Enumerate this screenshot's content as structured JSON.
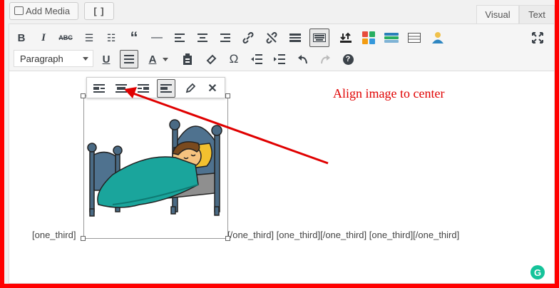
{
  "media": {
    "add_media_label": "Add Media",
    "shortcode_label": "[ ]"
  },
  "tabs": {
    "visual": "Visual",
    "text": "Text"
  },
  "toolbar": {
    "format_select": "Paragraph",
    "buttons_row1": [
      "bold",
      "italic",
      "strikethrough",
      "bulleted-list",
      "numbered-list",
      "blockquote",
      "horizontal-line",
      "align-left",
      "align-center",
      "align-right",
      "insert-link",
      "remove-link",
      "read-more",
      "toolbar-toggle",
      "insert-file",
      "colorful-grid",
      "shortcode-bars",
      "table",
      "user"
    ],
    "buttons_row2": [
      "underline",
      "justify",
      "text-color",
      "paste-as-text",
      "clear-formatting",
      "special-character",
      "decrease-indent",
      "increase-indent",
      "undo",
      "redo",
      "help"
    ]
  },
  "image_toolbar": [
    "align-left",
    "align-center",
    "align-right",
    "no-alignment",
    "edit",
    "remove"
  ],
  "shortcode_text_left": "[one_third]",
  "shortcode_text_right": "[/one_third] [one_third][/one_third] [one_third][/one_third]",
  "annotation": {
    "text": "Align image to center",
    "color": "#e00000"
  },
  "grammarly_letter": "G",
  "colors": {
    "frame": "#ff0000",
    "toolbar_bg": "#f5f5f5"
  }
}
